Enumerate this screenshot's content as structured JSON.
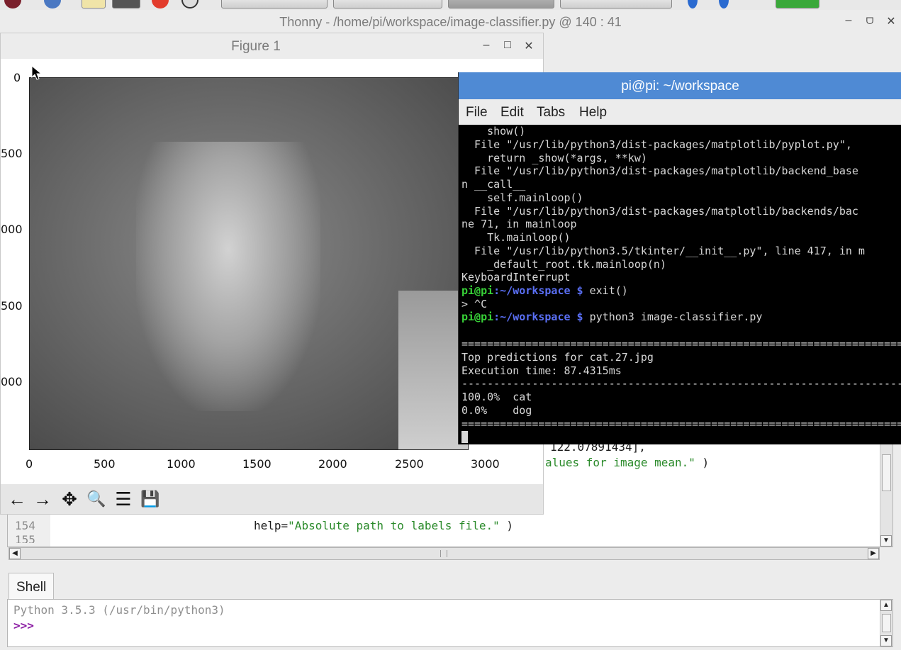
{
  "thonny": {
    "title": "Thonny  -  /home/pi/workspace/image-classifier.py  @  140 : 41",
    "controls": {
      "minimize": "–",
      "restore": "ᗜ",
      "close": "✕"
    }
  },
  "figure": {
    "title": "Figure 1",
    "controls": {
      "minimize": "–",
      "maximize": "□",
      "close": "✕"
    },
    "y_ticks": [
      "0",
      "500",
      "000",
      "500",
      "000"
    ],
    "x_ticks": [
      "0",
      "500",
      "1000",
      "1500",
      "2000",
      "2500",
      "3000"
    ],
    "toolbar": [
      "←",
      "→",
      "✥",
      "🔍",
      "☰",
      "💾"
    ]
  },
  "terminal": {
    "title": "pi@pi: ~/workspace",
    "menu": [
      "File",
      "Edit",
      "Tabs",
      "Help"
    ],
    "lines": [
      "    show()",
      "  File \"/usr/lib/python3/dist-packages/matplotlib/pyplot.py\",",
      "    return _show(*args, **kw)",
      "  File \"/usr/lib/python3/dist-packages/matplotlib/backend_base",
      "n __call__",
      "    self.mainloop()",
      "  File \"/usr/lib/python3/dist-packages/matplotlib/backends/bac",
      "ne 71, in mainloop",
      "    Tk.mainloop()",
      "  File \"/usr/lib/python3.5/tkinter/__init__.py\", line 417, in m",
      "    _default_root.tk.mainloop(n)",
      "KeyboardInterrupt"
    ],
    "prompt_user": "pi@pi",
    "prompt_path": ":~/workspace $",
    "cmd1": " exit()",
    "ctrl_c": "> ^C",
    "cmd2": " python3 image-classifier.py",
    "rule": "==========================================================================",
    "dash_rule": "--------------------------------------------------------------------------",
    "top_pred": "Top predictions for cat.27.jpg",
    "exec_time": "Execution time: 87.4315ms",
    "predictions": [
      {
        "pct": "100.0%",
        "label": "cat"
      },
      {
        "pct": "0.0%",
        "label": "dog"
      }
    ]
  },
  "editor": {
    "partial_line_a": "122.07891434],",
    "partial_line_b_text": "alues for image mean.\"",
    "partial_line_b_paren": " )",
    "line_154_num": "154",
    "line_154_code": "help=",
    "line_154_str": "\"Absolute path to labels file.\"",
    "line_154_end": " )",
    "line_155_num": "155"
  },
  "shell": {
    "tab_label": "Shell",
    "version_line": "Python 3.5.3 (/usr/bin/python3)",
    "prompt": ">>>"
  },
  "colors": {
    "terminal_title": "#4f8ad4",
    "prompt_green": "#37d137",
    "prompt_blue": "#5a6ff5",
    "shell_prompt": "#8b1ca3",
    "string_green": "#2a8a2a"
  }
}
